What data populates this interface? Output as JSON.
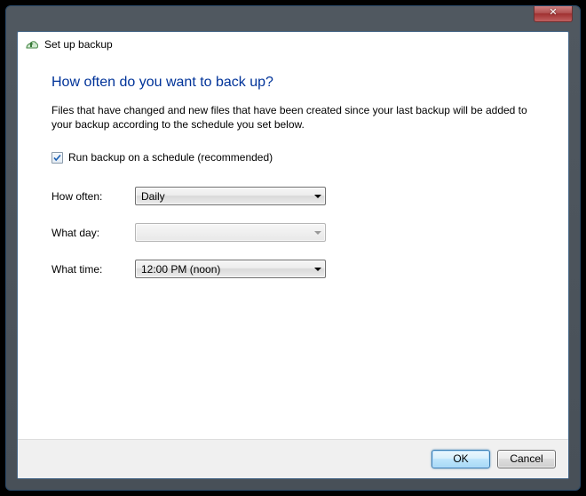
{
  "window": {
    "title": "Set up backup"
  },
  "page": {
    "heading": "How often do you want to back up?",
    "description": "Files that have changed and new files that have been created since your last backup will be added to your backup according to the schedule you set below."
  },
  "schedule": {
    "checkbox_label": "Run backup on a schedule (recommended)",
    "checked": true,
    "rows": {
      "how_often": {
        "label": "How often:",
        "value": "Daily",
        "enabled": true
      },
      "what_day": {
        "label": "What day:",
        "value": "",
        "enabled": false
      },
      "what_time": {
        "label": "What time:",
        "value": "12:00 PM (noon)",
        "enabled": true
      }
    }
  },
  "buttons": {
    "ok": "OK",
    "cancel": "Cancel"
  }
}
